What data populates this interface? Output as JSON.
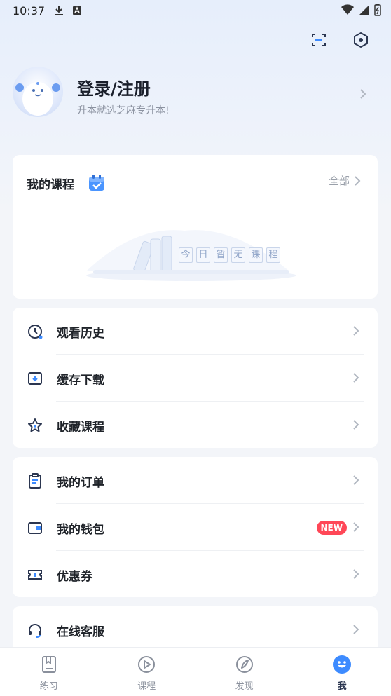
{
  "status_bar": {
    "time": "10:37"
  },
  "profile": {
    "name": "登录/注册",
    "subtitle": "升本就选芝麻专升本!"
  },
  "my_courses": {
    "title": "我的课程",
    "more_label": "全部",
    "empty_chars": [
      "今",
      "日",
      "暂",
      "无",
      "课",
      "程"
    ]
  },
  "menu_group_1": [
    {
      "label": "观看历史",
      "icon": "clock-icon"
    },
    {
      "label": "缓存下载",
      "icon": "download-icon"
    },
    {
      "label": "收藏课程",
      "icon": "star-icon"
    }
  ],
  "menu_group_2": [
    {
      "label": "我的订单",
      "icon": "clipboard-icon"
    },
    {
      "label": "我的钱包",
      "icon": "wallet-icon",
      "badge": "NEW"
    },
    {
      "label": "优惠券",
      "icon": "coupon-icon"
    }
  ],
  "menu_group_3": [
    {
      "label": "在线客服",
      "icon": "headset-icon"
    }
  ],
  "tabbar": [
    {
      "label": "练习",
      "icon": "book-icon",
      "active": false
    },
    {
      "label": "课程",
      "icon": "play-icon",
      "active": false
    },
    {
      "label": "发现",
      "icon": "compass-icon",
      "active": false
    },
    {
      "label": "我",
      "icon": "smile-icon",
      "active": true
    }
  ],
  "colors": {
    "accent": "#3d8bff",
    "badge": "#ff4757",
    "background": "#f3f5f9"
  }
}
